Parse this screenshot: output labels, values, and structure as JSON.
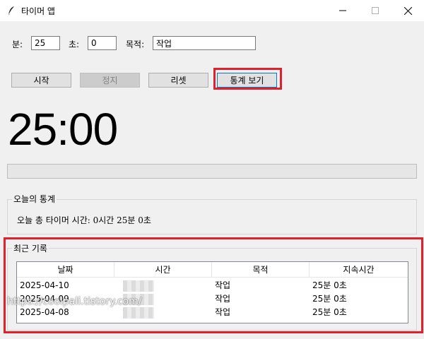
{
  "window": {
    "title": "타이머 앱",
    "icons": {
      "app": "feather-icon",
      "minimize": "minimize-icon",
      "maximize": "maximize-icon",
      "close": "close-icon"
    }
  },
  "settings": {
    "minutes_label": "분:",
    "minutes_value": "25",
    "seconds_label": "초:",
    "seconds_value": "0",
    "purpose_label": "목적:",
    "purpose_value": "작업"
  },
  "buttons": {
    "start": "시작",
    "stop": "정지",
    "reset": "리셋",
    "stats": "통계 보기"
  },
  "timer": {
    "display": "25:00",
    "progress": 0
  },
  "today_stats": {
    "title": "오늘의 통계",
    "text": "오늘 총 타이머 시간: 0시간 25분 0초"
  },
  "recent": {
    "title": "최근 기록",
    "columns": [
      "날짜",
      "시간",
      "목적",
      "지속시간"
    ],
    "rows": [
      {
        "date": "2025-04-10",
        "time": "",
        "purpose": "작업",
        "duration": "25분 0초"
      },
      {
        "date": "2025-04-09",
        "time": "",
        "purpose": "작업",
        "duration": "25분 0초"
      },
      {
        "date": "2025-04-08",
        "time": "",
        "purpose": "작업",
        "duration": "25분 0초"
      }
    ]
  },
  "watermark": "https://coolpali.tistory.com/",
  "colors": {
    "highlight": "#e0202a",
    "background": "#f0f0f0",
    "button": "#e1e1e1",
    "button_disabled": "#cccccc"
  }
}
